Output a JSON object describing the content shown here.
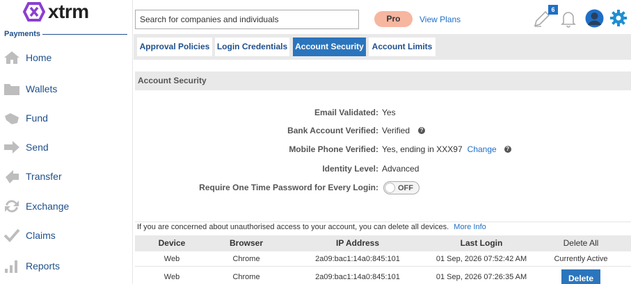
{
  "brand": {
    "name": "xtrm"
  },
  "sidebar": {
    "section": "Payments",
    "items": [
      {
        "label": "Home",
        "icon": "home-icon"
      },
      {
        "label": "Wallets",
        "icon": "folder-icon"
      },
      {
        "label": "Fund",
        "icon": "fund-icon"
      },
      {
        "label": "Send",
        "icon": "arrow-right-icon"
      },
      {
        "label": "Transfer",
        "icon": "transfer-icon"
      },
      {
        "label": "Exchange",
        "icon": "exchange-icon"
      },
      {
        "label": "Claims",
        "icon": "check-icon"
      },
      {
        "label": "Reports",
        "icon": "bar-chart-icon"
      }
    ]
  },
  "header": {
    "search_placeholder": "Search for companies and individuals",
    "plan": "Pro",
    "view_plans": "View Plans",
    "notification_count": "6",
    "accent": "#1f6fc5"
  },
  "tabs": [
    {
      "label": "Approval Policies"
    },
    {
      "label": "Login Credentials"
    },
    {
      "label": "Account Security",
      "active": true
    },
    {
      "label": "Account Limits"
    }
  ],
  "panel": {
    "title": "Account Security",
    "fields": {
      "email": {
        "label": "Email Validated:",
        "value": "Yes"
      },
      "bank": {
        "label": "Bank Account Verified:",
        "value": "Verified"
      },
      "phone": {
        "label": "Mobile Phone Verified:",
        "value": "Yes, ending in XXX97",
        "action": "Change"
      },
      "identity": {
        "label": "Identity Level:",
        "value": "Advanced"
      },
      "otp": {
        "label": "Require One Time Password for Every Login:",
        "value": "OFF"
      }
    }
  },
  "devices": {
    "notice": "If you are concerned about unauthorised access to your account, you can delete all devices.",
    "more_info": "More Info",
    "columns": {
      "device": "Device",
      "browser": "Browser",
      "ip": "IP Address",
      "last_login": "Last Login",
      "delete_all": "Delete All"
    },
    "rows": [
      {
        "device": "Web",
        "browser": "Chrome",
        "ip": "2a09:bac1:14a0:845:101",
        "last_login": "01 Sep, 2026 07:52:42 AM",
        "status": "Currently Active"
      },
      {
        "device": "Web",
        "browser": "Chrome",
        "ip": "2a09:bac1:14a0:845:101",
        "last_login": "01 Sep, 2026 07:26:35 AM",
        "action": "Delete"
      }
    ]
  }
}
